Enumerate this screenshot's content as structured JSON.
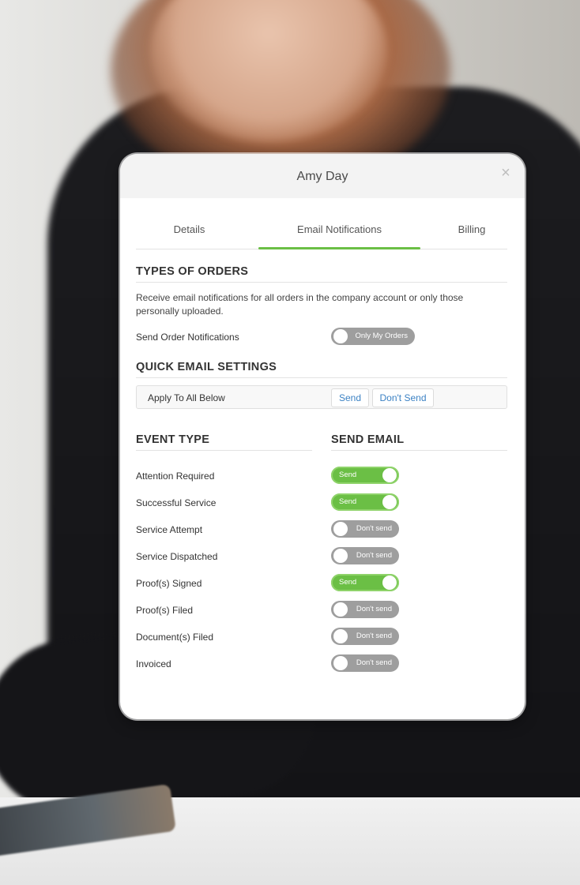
{
  "modal": {
    "title": "Amy Day",
    "close_icon": "close-icon"
  },
  "tabs": [
    {
      "label": "Details",
      "active": false
    },
    {
      "label": "Email Notifications",
      "active": true
    },
    {
      "label": "Billing",
      "active": false
    }
  ],
  "types_of_orders": {
    "title": "TYPES OF ORDERS",
    "description": "Receive email notifications for all orders in the company account or only those personally uploaded.",
    "send_label": "Send Order Notifications",
    "toggle_text": "Only My Orders",
    "toggle_on": false
  },
  "quick_settings": {
    "title": "QUICK EMAIL SETTINGS",
    "apply_label": "Apply To All Below",
    "send_button": "Send",
    "dont_send_button": "Don't Send"
  },
  "events": {
    "event_header": "EVENT TYPE",
    "send_header": "SEND EMAIL",
    "items": [
      {
        "label": "Attention Required",
        "state_text": "Send",
        "on": true
      },
      {
        "label": "Successful Service",
        "state_text": "Send",
        "on": true
      },
      {
        "label": "Service Attempt",
        "state_text": "Don't send",
        "on": false
      },
      {
        "label": "Service Dispatched",
        "state_text": "Don't send",
        "on": false
      },
      {
        "label": "Proof(s) Signed",
        "state_text": "Send",
        "on": true
      },
      {
        "label": "Proof(s) Filed",
        "state_text": "Don't send",
        "on": false
      },
      {
        "label": "Document(s) Filed",
        "state_text": "Don't send",
        "on": false
      },
      {
        "label": "Invoiced",
        "state_text": "Don't send",
        "on": false
      }
    ]
  },
  "colors": {
    "accent_green": "#6bbf45",
    "toggle_off": "#9e9e9e",
    "link_blue": "#3c82c4"
  }
}
